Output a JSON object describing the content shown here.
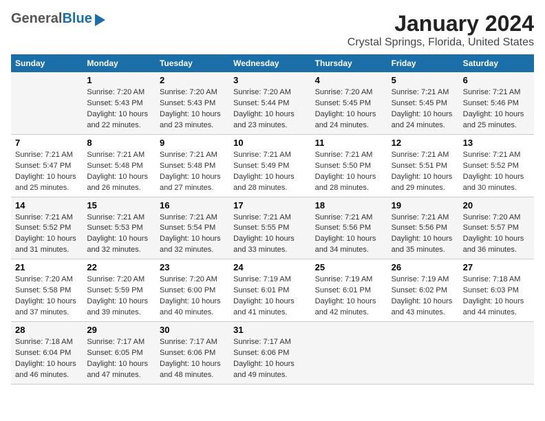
{
  "logo": {
    "general": "General",
    "blue": "Blue"
  },
  "title": "January 2024",
  "subtitle": "Crystal Springs, Florida, United States",
  "columns": [
    "Sunday",
    "Monday",
    "Tuesday",
    "Wednesday",
    "Thursday",
    "Friday",
    "Saturday"
  ],
  "weeks": [
    [
      {
        "day": "",
        "sunrise": "",
        "sunset": "",
        "daylight": ""
      },
      {
        "day": "1",
        "sunrise": "Sunrise: 7:20 AM",
        "sunset": "Sunset: 5:43 PM",
        "daylight": "Daylight: 10 hours and 22 minutes."
      },
      {
        "day": "2",
        "sunrise": "Sunrise: 7:20 AM",
        "sunset": "Sunset: 5:43 PM",
        "daylight": "Daylight: 10 hours and 23 minutes."
      },
      {
        "day": "3",
        "sunrise": "Sunrise: 7:20 AM",
        "sunset": "Sunset: 5:44 PM",
        "daylight": "Daylight: 10 hours and 23 minutes."
      },
      {
        "day": "4",
        "sunrise": "Sunrise: 7:20 AM",
        "sunset": "Sunset: 5:45 PM",
        "daylight": "Daylight: 10 hours and 24 minutes."
      },
      {
        "day": "5",
        "sunrise": "Sunrise: 7:21 AM",
        "sunset": "Sunset: 5:45 PM",
        "daylight": "Daylight: 10 hours and 24 minutes."
      },
      {
        "day": "6",
        "sunrise": "Sunrise: 7:21 AM",
        "sunset": "Sunset: 5:46 PM",
        "daylight": "Daylight: 10 hours and 25 minutes."
      }
    ],
    [
      {
        "day": "7",
        "sunrise": "Sunrise: 7:21 AM",
        "sunset": "Sunset: 5:47 PM",
        "daylight": "Daylight: 10 hours and 25 minutes."
      },
      {
        "day": "8",
        "sunrise": "Sunrise: 7:21 AM",
        "sunset": "Sunset: 5:48 PM",
        "daylight": "Daylight: 10 hours and 26 minutes."
      },
      {
        "day": "9",
        "sunrise": "Sunrise: 7:21 AM",
        "sunset": "Sunset: 5:48 PM",
        "daylight": "Daylight: 10 hours and 27 minutes."
      },
      {
        "day": "10",
        "sunrise": "Sunrise: 7:21 AM",
        "sunset": "Sunset: 5:49 PM",
        "daylight": "Daylight: 10 hours and 28 minutes."
      },
      {
        "day": "11",
        "sunrise": "Sunrise: 7:21 AM",
        "sunset": "Sunset: 5:50 PM",
        "daylight": "Daylight: 10 hours and 28 minutes."
      },
      {
        "day": "12",
        "sunrise": "Sunrise: 7:21 AM",
        "sunset": "Sunset: 5:51 PM",
        "daylight": "Daylight: 10 hours and 29 minutes."
      },
      {
        "day": "13",
        "sunrise": "Sunrise: 7:21 AM",
        "sunset": "Sunset: 5:52 PM",
        "daylight": "Daylight: 10 hours and 30 minutes."
      }
    ],
    [
      {
        "day": "14",
        "sunrise": "Sunrise: 7:21 AM",
        "sunset": "Sunset: 5:52 PM",
        "daylight": "Daylight: 10 hours and 31 minutes."
      },
      {
        "day": "15",
        "sunrise": "Sunrise: 7:21 AM",
        "sunset": "Sunset: 5:53 PM",
        "daylight": "Daylight: 10 hours and 32 minutes."
      },
      {
        "day": "16",
        "sunrise": "Sunrise: 7:21 AM",
        "sunset": "Sunset: 5:54 PM",
        "daylight": "Daylight: 10 hours and 32 minutes."
      },
      {
        "day": "17",
        "sunrise": "Sunrise: 7:21 AM",
        "sunset": "Sunset: 5:55 PM",
        "daylight": "Daylight: 10 hours and 33 minutes."
      },
      {
        "day": "18",
        "sunrise": "Sunrise: 7:21 AM",
        "sunset": "Sunset: 5:56 PM",
        "daylight": "Daylight: 10 hours and 34 minutes."
      },
      {
        "day": "19",
        "sunrise": "Sunrise: 7:21 AM",
        "sunset": "Sunset: 5:56 PM",
        "daylight": "Daylight: 10 hours and 35 minutes."
      },
      {
        "day": "20",
        "sunrise": "Sunrise: 7:20 AM",
        "sunset": "Sunset: 5:57 PM",
        "daylight": "Daylight: 10 hours and 36 minutes."
      }
    ],
    [
      {
        "day": "21",
        "sunrise": "Sunrise: 7:20 AM",
        "sunset": "Sunset: 5:58 PM",
        "daylight": "Daylight: 10 hours and 37 minutes."
      },
      {
        "day": "22",
        "sunrise": "Sunrise: 7:20 AM",
        "sunset": "Sunset: 5:59 PM",
        "daylight": "Daylight: 10 hours and 39 minutes."
      },
      {
        "day": "23",
        "sunrise": "Sunrise: 7:20 AM",
        "sunset": "Sunset: 6:00 PM",
        "daylight": "Daylight: 10 hours and 40 minutes."
      },
      {
        "day": "24",
        "sunrise": "Sunrise: 7:19 AM",
        "sunset": "Sunset: 6:01 PM",
        "daylight": "Daylight: 10 hours and 41 minutes."
      },
      {
        "day": "25",
        "sunrise": "Sunrise: 7:19 AM",
        "sunset": "Sunset: 6:01 PM",
        "daylight": "Daylight: 10 hours and 42 minutes."
      },
      {
        "day": "26",
        "sunrise": "Sunrise: 7:19 AM",
        "sunset": "Sunset: 6:02 PM",
        "daylight": "Daylight: 10 hours and 43 minutes."
      },
      {
        "day": "27",
        "sunrise": "Sunrise: 7:18 AM",
        "sunset": "Sunset: 6:03 PM",
        "daylight": "Daylight: 10 hours and 44 minutes."
      }
    ],
    [
      {
        "day": "28",
        "sunrise": "Sunrise: 7:18 AM",
        "sunset": "Sunset: 6:04 PM",
        "daylight": "Daylight: 10 hours and 46 minutes."
      },
      {
        "day": "29",
        "sunrise": "Sunrise: 7:17 AM",
        "sunset": "Sunset: 6:05 PM",
        "daylight": "Daylight: 10 hours and 47 minutes."
      },
      {
        "day": "30",
        "sunrise": "Sunrise: 7:17 AM",
        "sunset": "Sunset: 6:06 PM",
        "daylight": "Daylight: 10 hours and 48 minutes."
      },
      {
        "day": "31",
        "sunrise": "Sunrise: 7:17 AM",
        "sunset": "Sunset: 6:06 PM",
        "daylight": "Daylight: 10 hours and 49 minutes."
      },
      {
        "day": "",
        "sunrise": "",
        "sunset": "",
        "daylight": ""
      },
      {
        "day": "",
        "sunrise": "",
        "sunset": "",
        "daylight": ""
      },
      {
        "day": "",
        "sunrise": "",
        "sunset": "",
        "daylight": ""
      }
    ]
  ]
}
